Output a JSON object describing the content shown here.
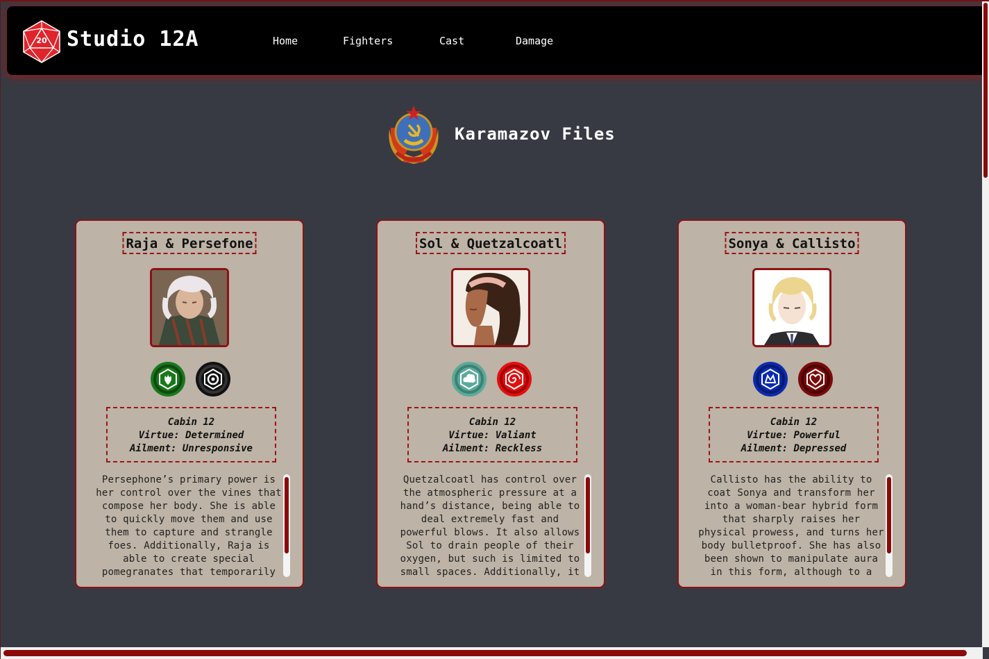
{
  "nav": {
    "brand": "Studio 12A",
    "links": [
      "Home",
      "Fighters",
      "Cast",
      "Damage"
    ]
  },
  "header": {
    "title": "Karamazov Files"
  },
  "cards": [
    {
      "name": "Raja & Persefone",
      "cabin": "Cabin 12",
      "virtue": "Virtue: Determined",
      "ailment": "Ailment: Unresponsive",
      "bio": "Persephone’s primary power is her control over the vines that compose her body. She is able to quickly move them and use them to capture and strangle foes. Additionally, Raja is able to create special pomegranates that temporarily",
      "badges": [
        {
          "icon": "leaf-flame-icon",
          "color": "#18781b"
        },
        {
          "icon": "flower-icon",
          "color": "#111111"
        }
      ]
    },
    {
      "name": "Sol & Quetzalcoatl",
      "cabin": "Cabin 12",
      "virtue": "Virtue: Valiant",
      "ailment": "Ailment: Reckless",
      "bio": "Quetzalcoatl has control over the atmospheric pressure at a hand’s distance, being able to deal extremely fast and powerful blows. It also allows Sol to drain people of their oxygen, but such is limited to small spaces. Additionally, it",
      "badges": [
        {
          "icon": "cloud-icon",
          "color": "#5aaa9a"
        },
        {
          "icon": "spiral-icon",
          "color": "#e01010"
        }
      ]
    },
    {
      "name": "Sonya & Callisto",
      "cabin": "Cabin 12",
      "virtue": "Virtue: Powerful",
      "ailment": "Ailment: Depressed",
      "bio": "Callisto has the ability to coat Sonya and transform her into a woman-bear hybrid form that sharply raises her physical prowess, and turns her body bulletproof. She has also been shown to manipulate aura in this form, although to a",
      "badges": [
        {
          "icon": "beast-icon",
          "color": "#0a2ab0"
        },
        {
          "icon": "heart-icon",
          "color": "#7a0a0a"
        }
      ]
    }
  ]
}
